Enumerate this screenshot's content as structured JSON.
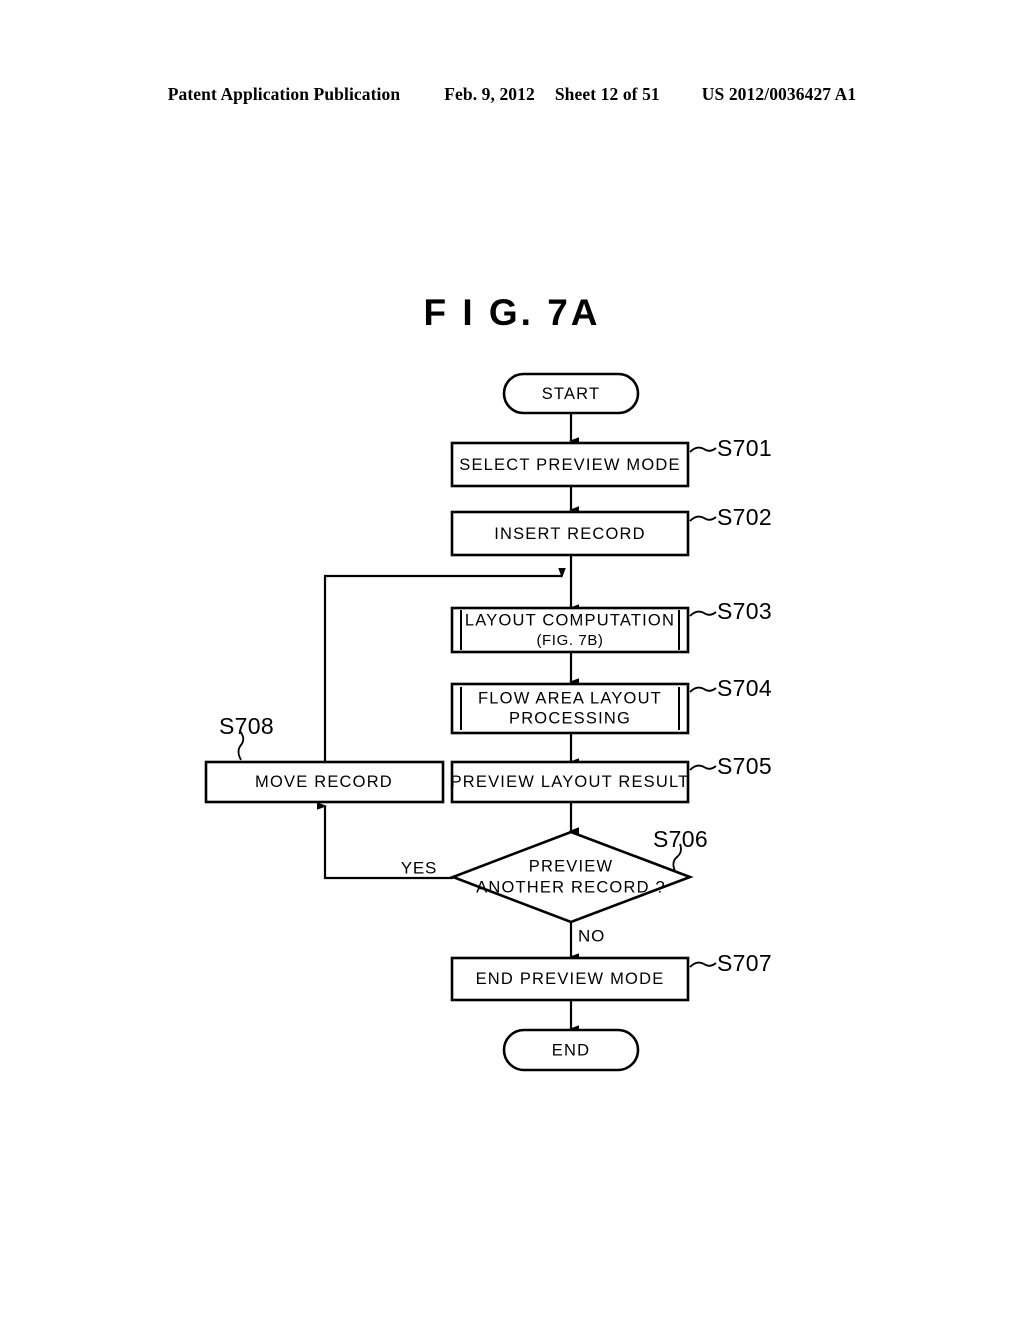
{
  "header": {
    "publication": "Patent Application Publication",
    "date": "Feb. 9, 2012",
    "sheet": "Sheet 12 of 51",
    "number": "US 2012/0036427 A1"
  },
  "figure": {
    "title": "F I G.  7A"
  },
  "flowchart": {
    "type": "flowchart",
    "nodes": [
      {
        "id": "start",
        "shape": "terminator",
        "label": "START",
        "step": ""
      },
      {
        "id": "s701",
        "shape": "process",
        "label": "SELECT PREVIEW MODE",
        "step": "S701"
      },
      {
        "id": "s702",
        "shape": "process",
        "label": "INSERT RECORD",
        "step": "S702"
      },
      {
        "id": "s703",
        "shape": "predefined-process",
        "label": "LAYOUT COMPUTATION",
        "sublabel": "(FIG. 7B)",
        "step": "S703"
      },
      {
        "id": "s704",
        "shape": "predefined-process",
        "label": "FLOW AREA LAYOUT",
        "sublabel": "PROCESSING",
        "step": "S704"
      },
      {
        "id": "s705",
        "shape": "process",
        "label": "PREVIEW LAYOUT RESULT",
        "step": "S705"
      },
      {
        "id": "s706",
        "shape": "decision",
        "label": "PREVIEW",
        "sublabel": "ANOTHER RECORD ?",
        "step": "S706"
      },
      {
        "id": "s707",
        "shape": "process",
        "label": "END PREVIEW MODE",
        "step": "S707"
      },
      {
        "id": "end",
        "shape": "terminator",
        "label": "END",
        "step": ""
      },
      {
        "id": "s708",
        "shape": "process",
        "label": "MOVE RECORD",
        "step": "S708"
      }
    ],
    "edges": [
      {
        "from": "start",
        "to": "s701",
        "label": ""
      },
      {
        "from": "s701",
        "to": "s702",
        "label": ""
      },
      {
        "from": "s702",
        "to": "s703",
        "label": ""
      },
      {
        "from": "s703",
        "to": "s704",
        "label": ""
      },
      {
        "from": "s704",
        "to": "s705",
        "label": ""
      },
      {
        "from": "s705",
        "to": "s706",
        "label": ""
      },
      {
        "from": "s706",
        "to": "s708",
        "label": "YES"
      },
      {
        "from": "s706",
        "to": "s707",
        "label": "NO"
      },
      {
        "from": "s708",
        "to": "s703",
        "label": ""
      },
      {
        "from": "s707",
        "to": "end",
        "label": ""
      }
    ],
    "branch_labels": {
      "yes": "YES",
      "no": "NO"
    }
  }
}
